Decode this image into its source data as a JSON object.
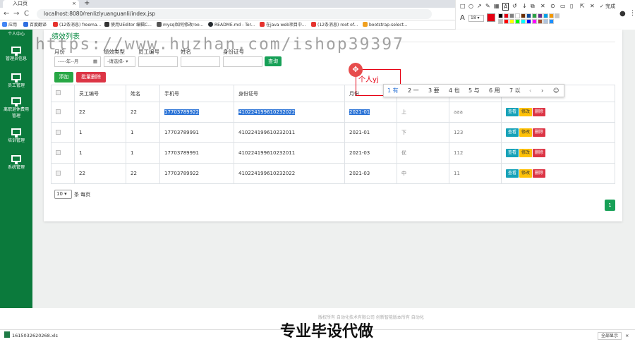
{
  "browser": {
    "tab_title": "入口页",
    "new_tab": "+",
    "url": "localhost:8080/renlizlyuanguanli/index.jsp",
    "bookmarks": [
      "应用",
      "百度翻译",
      "(12条消息) freema...",
      "使用UEditor 编辑C...",
      "mysql如何修改roo...",
      "README.md - Ter...",
      "在java web项目中...",
      "(12条消息) root of...",
      "bootstrap-select..."
    ]
  },
  "sidebar": {
    "header": "个人中心",
    "items": [
      "管理员信息",
      "员工管理",
      "离职退休费用管理",
      "培训管理",
      "系统管理"
    ]
  },
  "page": {
    "title": "绩效列表",
    "filters": {
      "month_label": "月份",
      "type_label": "绩效类型",
      "emp_no_label": "员工编号",
      "name_label": "姓名",
      "id_label": "身份证号",
      "month_placeholder": "-----年--月",
      "type_select": "-请选择-",
      "query_btn": "查询"
    },
    "add_btn": "添加",
    "batch_delete_btn": "批量删除",
    "table": {
      "headers": [
        "员工编号",
        "姓名",
        "手机号",
        "身份证号",
        "月份"
      ],
      "rows": [
        {
          "emp_no": "22",
          "name": "22",
          "phone": "17703789922",
          "id": "410224199610232022",
          "month": "2021-01",
          "type": "上",
          "score": "aaa"
        },
        {
          "emp_no": "1",
          "name": "1",
          "phone": "17703789991",
          "id": "410224199610232011",
          "month": "2021-01",
          "type": "下",
          "score": "123"
        },
        {
          "emp_no": "1",
          "name": "1",
          "phone": "17703789991",
          "id": "410224199610232011",
          "month": "2021-03",
          "type": "优",
          "score": "112"
        },
        {
          "emp_no": "22",
          "name": "22",
          "phone": "17703789922",
          "id": "410224199610232022",
          "month": "2021-03",
          "type": "中",
          "score": "11"
        }
      ],
      "actions": {
        "view": "查看",
        "edit": "修改",
        "delete": "删除"
      }
    },
    "page_size": "10",
    "per_page_label": "条 每页",
    "current_page": "1"
  },
  "ime": {
    "typed": "个人yj",
    "candidates": [
      "1 有",
      "2 一",
      "3 要",
      "4 也",
      "5 与",
      "6 用",
      "7 以"
    ],
    "prev": "‹",
    "next": "›",
    "emoji": "☺"
  },
  "screenshot_tool": {
    "font_label": "A",
    "font_size": "18",
    "done": "完成",
    "colors": [
      "#000000",
      "#e60012",
      "#808080",
      "#ffffff",
      "#6b2c00",
      "#0f4c9c",
      "#2ba245",
      "#6d2e8e",
      "#00a0e9",
      "#f39800",
      "#c7c7c7",
      "#bfbfbf",
      "#ff0000",
      "#ffff00",
      "#00ff00",
      "#00ffff",
      "#0000ff",
      "#ff00ff",
      "#a0522d",
      "#b0c4de",
      "#1e90ff"
    ]
  },
  "footer_text": "版权所有 自动化技术有限公司 创新智能版本所有 自动化",
  "download": {
    "file": "1615032620268.xls",
    "show_all": "全部显示"
  },
  "watermark": "https://www.huzhan.com/ishop39397",
  "caption": "专业毕设代做",
  "colors": {
    "sidebar": "#0b7a3c",
    "add": "#28a745",
    "danger": "#dc3545",
    "info": "#17a2b8",
    "warning": "#ffc107",
    "pager": "#17a057"
  }
}
